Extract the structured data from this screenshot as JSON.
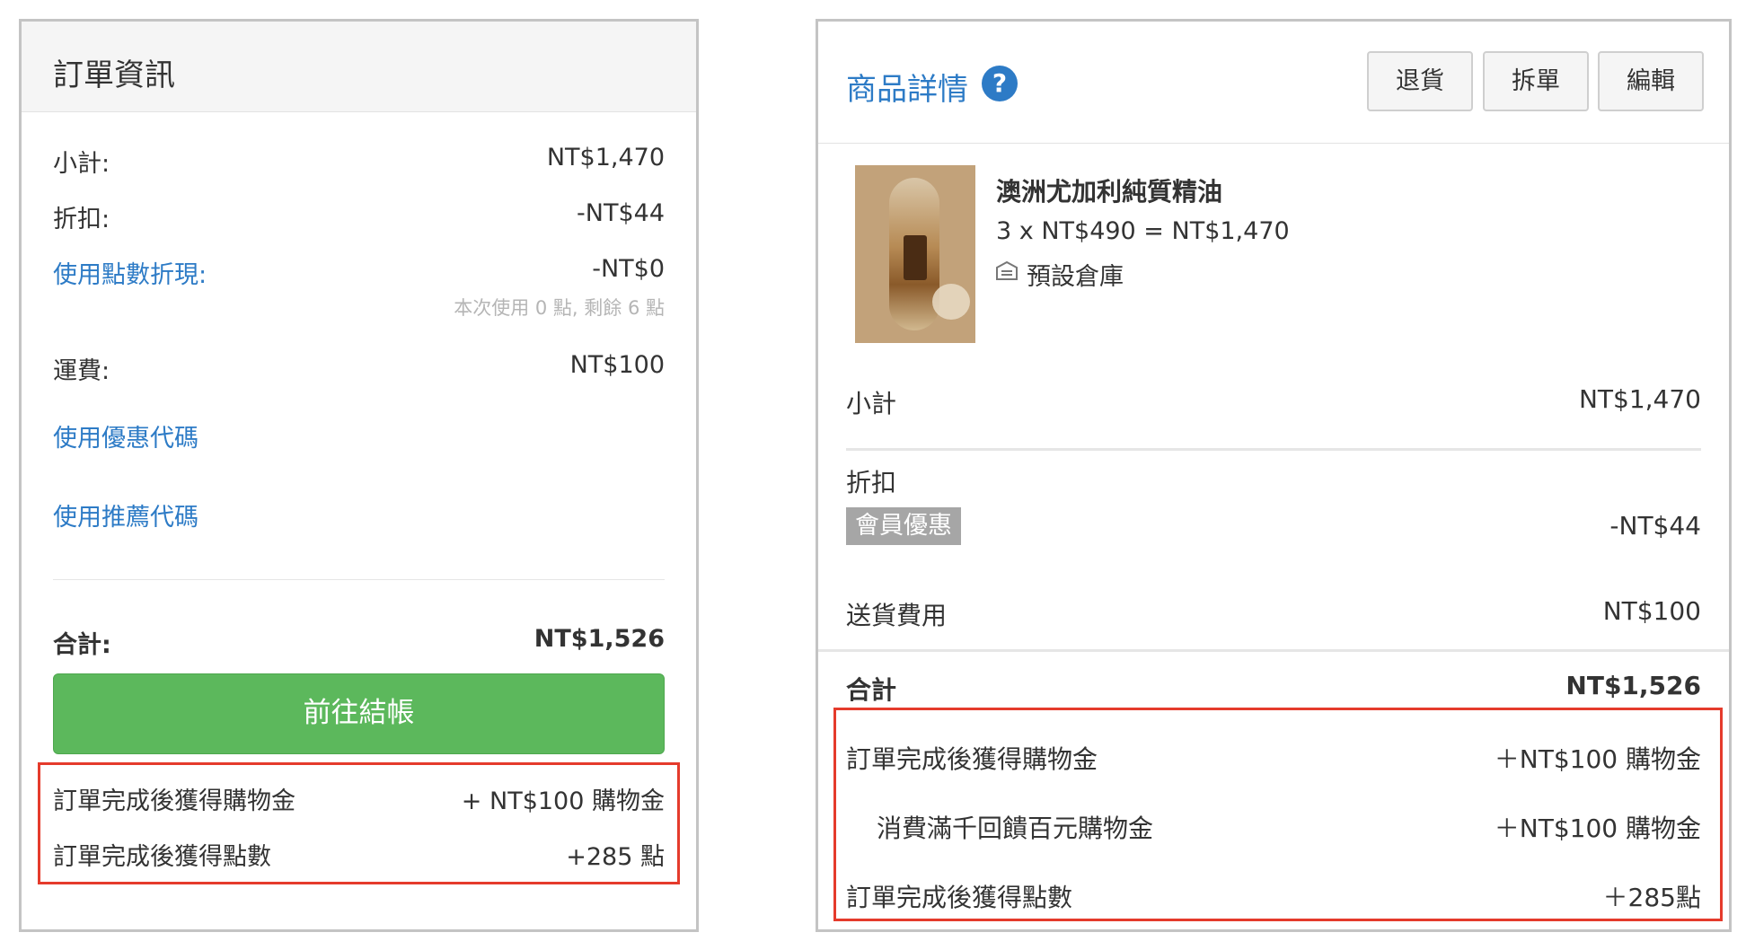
{
  "order_info": {
    "title": "訂單資訊",
    "subtotal_label": "小計:",
    "subtotal_value": "NT$1,470",
    "discount_label": "折扣:",
    "discount_value": "-NT$44",
    "points_label": "使用點數折現:",
    "points_value": "-NT$0",
    "points_hint": "本次使用 0 點, 剩餘 6 點",
    "shipping_label": "運費:",
    "shipping_value": "NT$100",
    "coupon_link": "使用優惠代碼",
    "referral_link": "使用推薦代碼",
    "total_label": "合計:",
    "total_value": "NT$1,526",
    "checkout_button": "前往結帳",
    "reward_credit_label": "訂單完成後獲得購物金",
    "reward_credit_value": "+ NT$100 購物金",
    "reward_points_label": "訂單完成後獲得點數",
    "reward_points_value": "+285 點"
  },
  "product_details": {
    "title": "商品詳情",
    "help_icon": "?",
    "buttons": {
      "return": "退貨",
      "split": "拆單",
      "edit": "編輯"
    },
    "product_name": "澳洲尤加利純質精油",
    "product_qty": "3 x NT$490 = NT$1,470",
    "warehouse": "預設倉庫",
    "subtotal_label": "小計",
    "subtotal_value": "NT$1,470",
    "discount_label": "折扣",
    "member_badge": "會員優惠",
    "discount_value": "-NT$44",
    "shipping_label": "送貨費用",
    "shipping_value": "NT$100",
    "total_label": "合計",
    "total_value": "NT$1,526",
    "reward_credit_label": "訂單完成後獲得購物金",
    "reward_credit_value": "＋NT$100 購物金",
    "reward_sub_label": "消費滿千回饋百元購物金",
    "reward_sub_value": "＋NT$100 購物金",
    "reward_points_label": "訂單完成後獲得點數",
    "reward_points_value": "＋285點"
  },
  "colors": {
    "link": "#2d7bc6",
    "checkout": "#5cb85c",
    "highlight_border": "#e53b2c",
    "badge": "#a6a6a6"
  }
}
